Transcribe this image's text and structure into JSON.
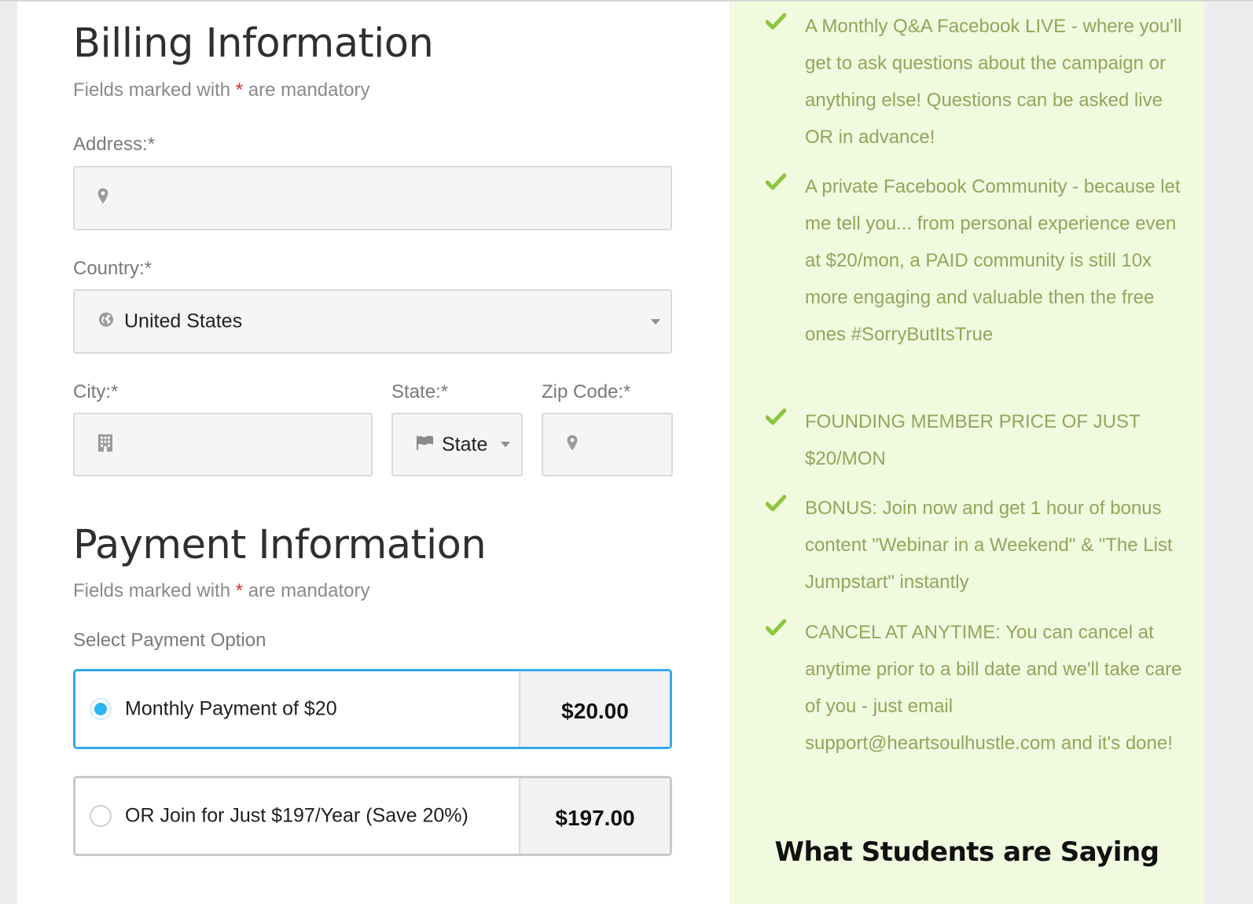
{
  "billing": {
    "title": "Billing Information",
    "mandatory_prefix": "Fields marked with",
    "mandatory_star": "*",
    "mandatory_suffix": "are mandatory",
    "address_label": "Address:*",
    "address_value": "",
    "country_label": "Country:*",
    "country_value": "United States",
    "city_label": "City:*",
    "city_value": "",
    "state_label": "State:*",
    "state_value": "State",
    "zip_label": "Zip Code:*",
    "zip_value": ""
  },
  "payment": {
    "title": "Payment Information",
    "mandatory_prefix": "Fields marked with",
    "mandatory_star": "*",
    "mandatory_suffix": "are mandatory",
    "select_label": "Select Payment Option",
    "options": [
      {
        "label": "Monthly Payment of $20",
        "amount": "$20.00",
        "selected": true
      },
      {
        "label": "OR Join for Just $197/Year (Save 20%)",
        "amount": "$197.00",
        "selected": false
      }
    ]
  },
  "benefits": [
    "A Monthly Q&A Facebook LIVE - where you'll get to ask questions about the campaign or anything else! Questions can be asked live OR in advance!",
    "A private Facebook Community - because let me tell you... from personal experience even at $20/mon, a PAID community is still 10x more engaging and valuable then the free ones #SorryButItsTrue",
    "FOUNDING MEMBER PRICE OF JUST $20/MON",
    "BONUS: Join now and get 1 hour of bonus content \"Webinar in a Weekend\" & \"The List Jumpstart\" instantly",
    "CANCEL AT ANYTIME: You can cancel at anytime prior to a bill date and we'll take care of you - just email support@heartsoulhustle.com and it's done!"
  ],
  "students_title": "What Students are Saying",
  "icons": {
    "address": "map-marker-icon",
    "country": "globe-icon",
    "city": "building-icon",
    "state": "flag-icon",
    "zip": "map-marker-icon",
    "benefit": "check-icon"
  },
  "colors": {
    "accent_blue": "#35a8ee",
    "radio_fill": "#2cb3f2",
    "required_star": "#d4322e",
    "check_green": "#8cc63e",
    "benefit_text": "#8fa85b",
    "benefit_bg": "#f1f9df"
  }
}
